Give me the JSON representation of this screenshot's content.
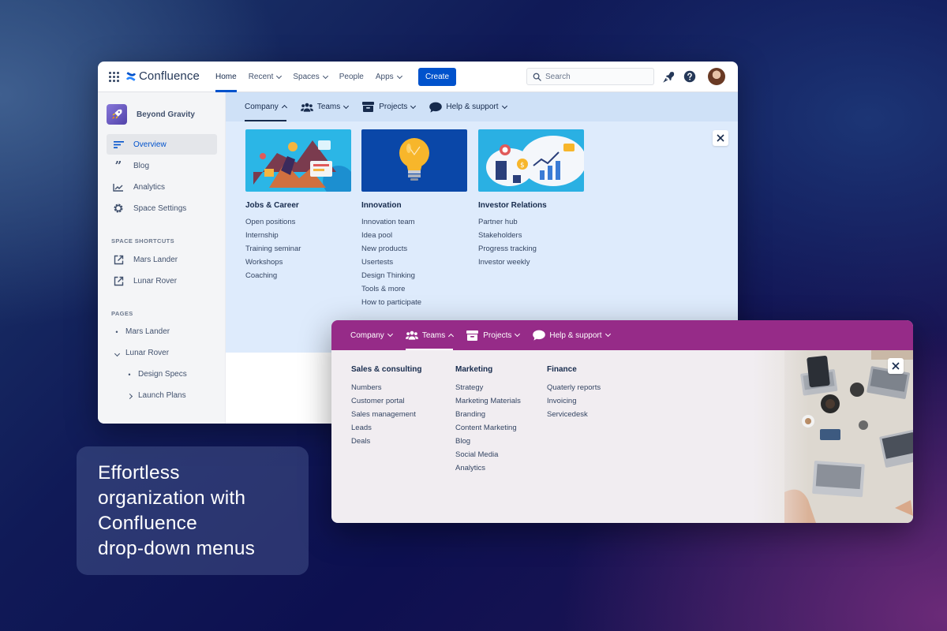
{
  "app": {
    "name": "Confluence",
    "top_nav": [
      {
        "label": "Home",
        "active": true,
        "dropdown": false
      },
      {
        "label": "Recent",
        "active": false,
        "dropdown": true
      },
      {
        "label": "Spaces",
        "active": false,
        "dropdown": true
      },
      {
        "label": "People",
        "active": false,
        "dropdown": false
      },
      {
        "label": "Apps",
        "active": false,
        "dropdown": true
      }
    ],
    "create_label": "Create",
    "search_placeholder": "Search",
    "icons": [
      "app-switcher-icon",
      "notifications-icon",
      "help-icon",
      "user-avatar"
    ],
    "accent_color": "#0052cc"
  },
  "sidebar": {
    "space_name": "Beyond Gravity",
    "items": [
      {
        "label": "Overview",
        "icon": "overview-icon",
        "active": true
      },
      {
        "label": "Blog",
        "icon": "quote-icon",
        "active": false
      },
      {
        "label": "Analytics",
        "icon": "analytics-icon",
        "active": false
      },
      {
        "label": "Space Settings",
        "icon": "gear-icon",
        "active": false
      }
    ],
    "shortcuts_heading": "SPACE SHORTCUTS",
    "shortcuts": [
      {
        "label": "Mars Lander",
        "icon": "external-link-icon"
      },
      {
        "label": "Lunar Rover",
        "icon": "external-link-icon"
      }
    ],
    "pages_heading": "PAGES",
    "pages": [
      {
        "label": "Mars Lander",
        "marker": "bullet"
      },
      {
        "label": "Lunar Rover",
        "marker": "expanded"
      },
      {
        "label": "Design Specs",
        "marker": "bullet"
      },
      {
        "label": "Launch Plans",
        "marker": "collapsed"
      }
    ]
  },
  "menu_blue": {
    "background": "#deebfc",
    "bar_items": [
      {
        "label": "Company",
        "active": true,
        "icon": ""
      },
      {
        "label": "Teams",
        "active": false,
        "icon": "people-icon"
      },
      {
        "label": "Projects",
        "active": false,
        "icon": "archive-box-icon"
      },
      {
        "label": "Help & support",
        "active": false,
        "icon": "chat-bubble-icon"
      }
    ],
    "columns": [
      {
        "title": "Jobs & Career",
        "links": [
          "Open positions",
          "Internship",
          "Training seminar",
          "Workshops",
          "Coaching"
        ]
      },
      {
        "title": "Innovation",
        "links": [
          "Innovation team",
          "Idea pool",
          "New products",
          "Usertests",
          "Design Thinking",
          "Tools & more",
          "How to participate"
        ]
      },
      {
        "title": "Investor Relations",
        "links": [
          "Partner hub",
          "Stakeholders",
          "Progress tracking",
          "Investor weekly"
        ]
      }
    ]
  },
  "menu_purple": {
    "bar_color": "#962b88",
    "bar_items": [
      {
        "label": "Company",
        "active": false,
        "icon": ""
      },
      {
        "label": "Teams",
        "active": true,
        "icon": "people-icon"
      },
      {
        "label": "Projects",
        "active": false,
        "icon": "archive-box-icon"
      },
      {
        "label": "Help & support",
        "active": false,
        "icon": "chat-bubble-icon"
      }
    ],
    "columns": [
      {
        "title": "Sales & consulting",
        "links": [
          "Numbers",
          "Customer portal",
          "Sales management",
          "Leads",
          "Deals"
        ]
      },
      {
        "title": "Marketing",
        "links": [
          "Strategy",
          "Marketing Materials",
          "Branding",
          "Content Marketing",
          "Blog",
          "Social Media",
          "Analytics"
        ]
      },
      {
        "title": "Finance",
        "links": [
          "Quaterly reports",
          "Invoicing",
          "Servicedesk"
        ]
      }
    ]
  },
  "caption": {
    "lines": [
      "Effortless",
      "organization with",
      "Confluence",
      "drop-down menus"
    ]
  }
}
